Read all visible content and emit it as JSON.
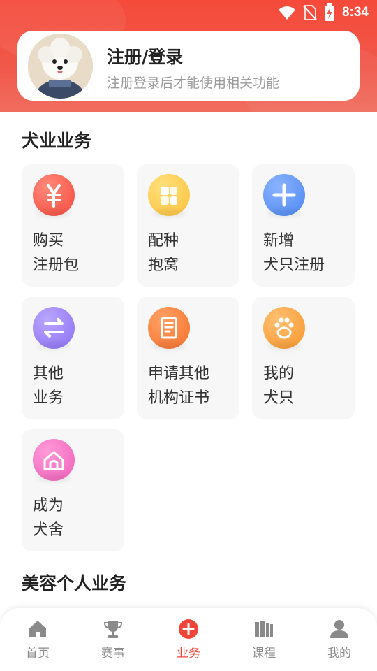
{
  "status_bar": {
    "time": "8:34",
    "icons": [
      "wifi-icon",
      "no-sim-icon",
      "battery-charging-icon"
    ]
  },
  "login_card": {
    "title": "注册/登录",
    "subtitle": "注册登录后才能使用相关功能"
  },
  "sections": {
    "dog_business": {
      "title": "犬业业务",
      "tiles": [
        {
          "line1": "购买",
          "line2": "注册包",
          "icon": "yen-icon",
          "color": "#f5493c"
        },
        {
          "line1": "配种",
          "line2": "抱窝",
          "icon": "blocks-icon",
          "color": "#fbc13c"
        },
        {
          "line1": "新增",
          "line2": "犬只注册",
          "icon": "plus-icon",
          "color": "#4a86f0"
        },
        {
          "line1": "其他",
          "line2": "业务",
          "icon": "swap-icon",
          "color": "#8b6ff2"
        },
        {
          "line1": "申请其他",
          "line2": "机构证书",
          "icon": "certificate-icon",
          "color": "#f5702a"
        },
        {
          "line1": "我的",
          "line2": "犬只",
          "icon": "paw-icon",
          "color": "#f7962c"
        },
        {
          "line1": "成为",
          "line2": "犬舍",
          "icon": "kennel-icon",
          "color": "#ee5fb9"
        }
      ]
    },
    "grooming": {
      "title": "美容个人业务"
    }
  },
  "bottom_nav": {
    "items": [
      {
        "label": "首页",
        "icon": "home-icon"
      },
      {
        "label": "赛事",
        "icon": "trophy-icon"
      },
      {
        "label": "业务",
        "icon": "add-circle-icon",
        "active": true
      },
      {
        "label": "课程",
        "icon": "books-icon"
      },
      {
        "label": "我的",
        "icon": "user-icon"
      }
    ],
    "active_color": "#f0463a",
    "inactive_color": "#8a8a8a"
  }
}
